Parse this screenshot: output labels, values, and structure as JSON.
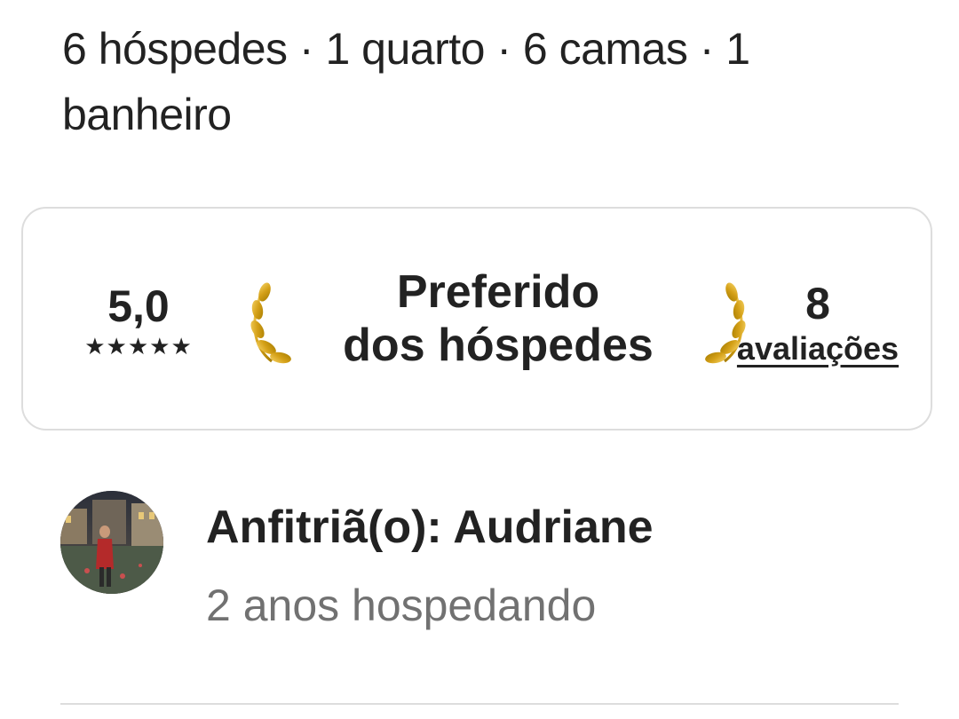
{
  "listing": {
    "summary": "6 hóspedes · 1 quarto · 6 camas · 1 banheiro"
  },
  "highlight_card": {
    "rating": {
      "value": "5,0",
      "stars": "★★★★★",
      "star_count": 5
    },
    "badge": {
      "line1": "Preferido",
      "line2": "dos hóspedes",
      "icon": "laurel-wreath-icon",
      "accent_color": "#D4A017"
    },
    "reviews": {
      "count": "8",
      "label": "avaliações"
    }
  },
  "host": {
    "name": "Anfitriã(o): Audriane",
    "tenure": "2 anos hospedando",
    "avatar_icon": "host-avatar"
  },
  "colors": {
    "text_primary": "#222222",
    "text_secondary": "#717171",
    "border": "#DDDDDD",
    "background": "#FFFFFF"
  }
}
